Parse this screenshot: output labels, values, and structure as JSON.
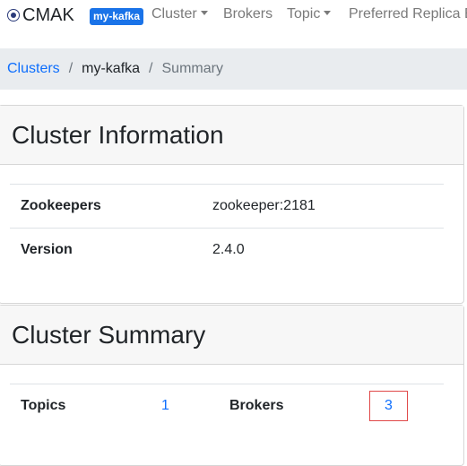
{
  "navbar": {
    "brand": "CMAK",
    "cluster_badge": "my-kafka",
    "items": [
      {
        "label": "Cluster",
        "dropdown": true
      },
      {
        "label": "Brokers",
        "dropdown": false
      },
      {
        "label": "Topic",
        "dropdown": true
      },
      {
        "label": "Preferred Replica Election",
        "dropdown": false
      }
    ]
  },
  "breadcrumb": {
    "items": [
      "Clusters",
      "my-kafka",
      "Summary"
    ]
  },
  "cluster_information": {
    "title": "Cluster Information",
    "rows": [
      {
        "label": "Zookeepers",
        "value": "zookeeper:2181"
      },
      {
        "label": "Version",
        "value": "2.4.0"
      }
    ]
  },
  "cluster_summary": {
    "title": "Cluster Summary",
    "topics_label": "Topics",
    "topics_value": "1",
    "brokers_label": "Brokers",
    "brokers_value": "3"
  },
  "colors": {
    "link": "#0d6efd",
    "badge": "#1a73e8",
    "highlight_border": "#e04848"
  }
}
